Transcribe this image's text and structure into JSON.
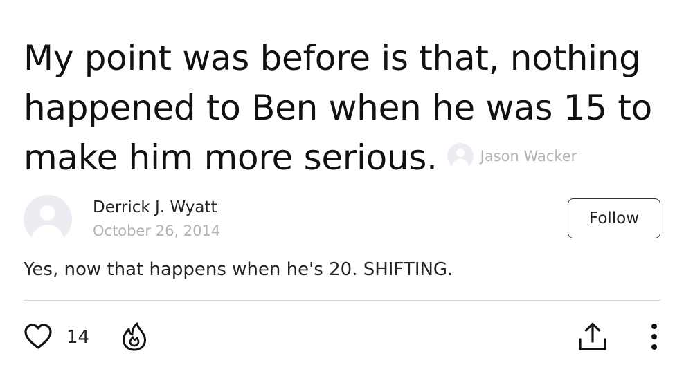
{
  "quote": {
    "text": "My point was before is that, nothing happened to Ben when he was 15 to make him more serious.",
    "author": "Jason Wacker"
  },
  "comment": {
    "author": "Derrick J. Wyatt",
    "date": "October 26, 2014",
    "follow_label": "Follow",
    "text": "Yes, now that happens when he's 20. SHIFTING."
  },
  "actions": {
    "like_count": "14",
    "icons": [
      "heart-icon",
      "fire-icon",
      "share-icon",
      "more-icon"
    ]
  },
  "colors": {
    "text": "#111111",
    "muted": "#b3b3b3",
    "avatar_bg": "#ecedf2",
    "divider": "#d9d9d9"
  }
}
